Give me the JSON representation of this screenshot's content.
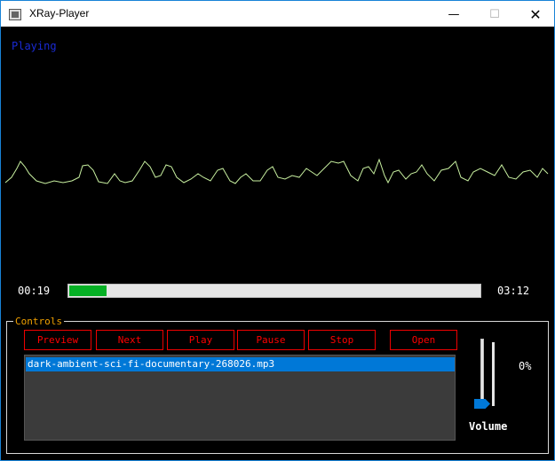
{
  "window": {
    "title": "XRay-Player",
    "minimize": "—",
    "maximize": "☐",
    "close": "✕"
  },
  "player": {
    "status": "Playing",
    "elapsed": "00:19",
    "duration": "03:12",
    "progress_fraction": 0.09,
    "progress_color": "#06b025",
    "status_color": "#1a2bd6",
    "waveform_color": "#c8f0a0"
  },
  "controls": {
    "label": "Controls",
    "buttons": [
      "Preview",
      "Next",
      "Play",
      "Pause",
      "Stop",
      "Open"
    ],
    "playlist": [
      "dark-ambient-sci-fi-documentary-268026.mp3"
    ],
    "volume": {
      "label": "Volume",
      "percent_text": "0%",
      "level": 0.0
    }
  }
}
